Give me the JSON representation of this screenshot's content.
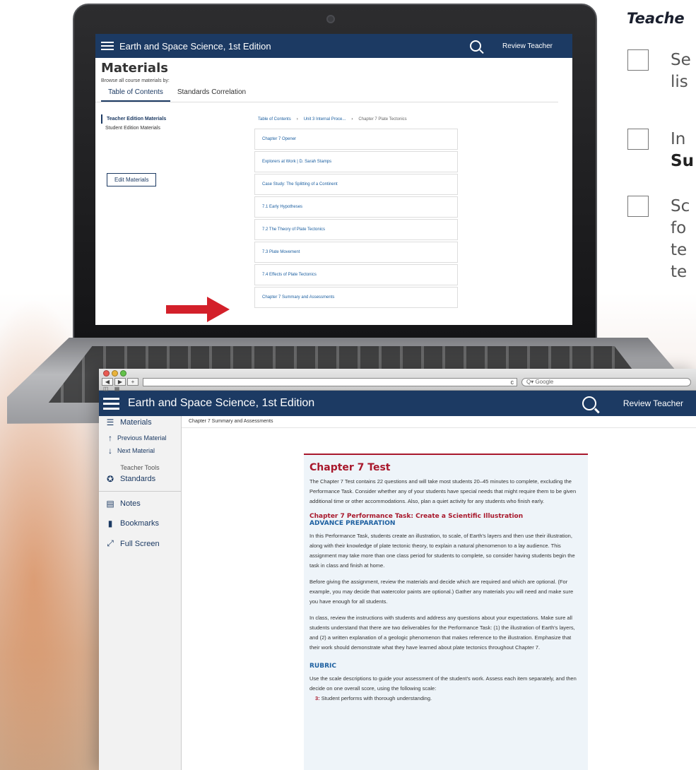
{
  "laptop": {
    "app_title": "Earth and Space Science, 1st Edition",
    "user": "Review Teacher",
    "page_title": "Materials",
    "browse_label": "Browse all course materials by:",
    "tabs": [
      "Table of Contents",
      "Standards Correlation"
    ],
    "side_items": [
      "Teacher Edition Materials",
      "Student Edition Materials"
    ],
    "edit_button": "Edit Materials",
    "breadcrumbs": [
      "Table of Contents",
      "Unit 3 Internal Proce...",
      "Chapter 7 Plate Tectonics"
    ],
    "chapter_items": [
      "Chapter 7 Opener",
      "Explorers at Work | D. Sarah Stamps",
      "Case Study: The Splitting of a Continent",
      "7.1 Early Hypotheses",
      "7.2 The Theory of Plate Tectonics",
      "7.3 Plate Movement",
      "7.4 Effects of Plate Tectonics",
      "Chapter 7 Summary and Assessments"
    ],
    "arrow_color": "#d3202a"
  },
  "checklist": {
    "title": "Teache",
    "items": [
      {
        "line1": "Se",
        "line2": "lis"
      },
      {
        "line1": "In",
        "line2": "Su"
      },
      {
        "line1": "Sc",
        "line2": "fo",
        "line3": "te",
        "line4": "te"
      }
    ]
  },
  "browser": {
    "search_placeholder": "Q▾ Google",
    "nav_back": "◀",
    "nav_fwd": "▶",
    "nav_add": "+",
    "reload": "c",
    "app_title": "Earth and Space Science, 1st Edition",
    "user": "Review Teacher",
    "sidebar": {
      "materials": "Materials",
      "previous": "Previous Material",
      "next": "Next Material",
      "tools_heading": "Teacher Tools",
      "standards": "Standards",
      "notes": "Notes",
      "bookmarks": "Bookmarks",
      "fullscreen": "Full Screen"
    },
    "breadcrumb": "Chapter 7 Summary and Assessments",
    "doc": {
      "title": "Chapter 7 Test",
      "intro": "The Chapter 7 Test contains 22 questions and will take most students 20–45 minutes to complete, excluding the Performance Task. Consider whether any of your students have special needs that might require them to be given additional time or other accommodations. Also, plan a quiet activity for any students who finish early.",
      "task_heading": "Chapter 7 Performance Task: Create a Scientific Illustration",
      "prep_heading": "ADVANCE PREPARATION",
      "p1": "In this Performance Task, students create an illustration, to scale, of Earth's layers and then use their illustration, along with their knowledge of plate tectonic theory, to explain a natural phenomenon to a lay audience. This assignment may take more than one class period for students to complete, so consider having students begin the task in class and finish at home.",
      "p2": "Before giving the assignment, review the materials and decide which are required and which are optional. (For example, you may decide that watercolor paints are optional.) Gather any materials you will need and make sure you have enough for all students.",
      "p3": "In class, review the instructions with students and address any questions about your expectations. Make sure all students understand that there are two deliverables for the Performance Task: (1) the illustration of Earth's layers, and (2) a written explanation of a geologic phenomenon that makes reference to the illustration. Emphasize that their work should demonstrate what they have learned about plate tectonics throughout Chapter 7.",
      "rubric_heading": "RUBRIC",
      "rubric_text": "Use the scale descriptions to guide your assessment of the student's work. Assess each item separately, and then decide on one overall score, using the following scale:",
      "score_num": "3:",
      "score_text": "Student performs with thorough understanding."
    }
  }
}
